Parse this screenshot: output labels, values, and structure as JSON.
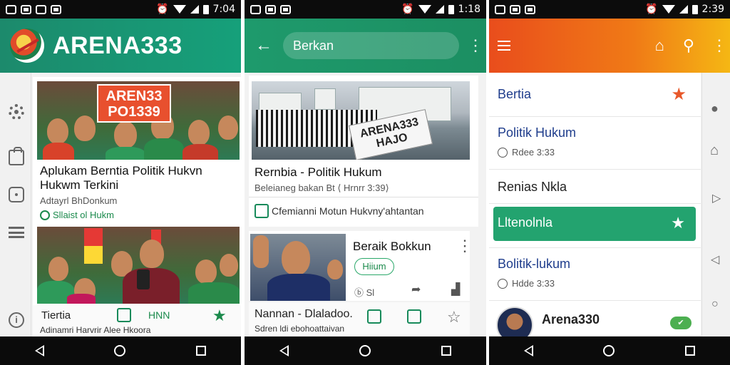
{
  "screens": [
    {
      "status": {
        "time": "7:04"
      },
      "brand": "ARENA333",
      "card1": {
        "sign_line1": "AREN33",
        "sign_line2": "PO1339",
        "title": "Aplukam Berntia Politik Hukvn Hukwm Terkini",
        "meta": "Adtayrl BhDonkum",
        "tag": "Sllaist ol Hukm"
      },
      "footer": {
        "label": "Tiertia",
        "tag": "HNN",
        "sub": "Adinamri Harvrir Alee Hkoora"
      }
    },
    {
      "status": {
        "time": "1:18"
      },
      "search_text": "Berkan",
      "card1": {
        "paper_text": "ARENA333 HAJO",
        "title": "Rernbia - Politik Hukum",
        "meta": "Beleianeg bakan Bt  ⟨ Hrnrr 3:39⟩",
        "footer": "Cfemianni Motun Hukvny'ahtantan"
      },
      "card2": {
        "title": "Beraik Bokkun",
        "pill": "Hiium",
        "count": "ⓑ Sl"
      },
      "card3": {
        "title": "Nannan - Dlaladoo.",
        "sub": "Sdren ldi ebohoattaivan"
      }
    },
    {
      "status": {
        "time": "2:39"
      },
      "items": [
        {
          "title": "Bertia",
          "meta": ""
        },
        {
          "title": "Politik Hukum",
          "meta": "Rdee 3:33"
        },
        {
          "title": "Renias Nkla",
          "meta": ""
        },
        {
          "title": "Lltenolnla",
          "meta": ""
        },
        {
          "title": "Bolitik-lukum",
          "meta": "Hdde 3:33"
        },
        {
          "title": "Arena330",
          "meta": ""
        }
      ],
      "badge": "✔",
      "colors": {
        "accent": "#23a36f",
        "star": "#e8582a",
        "title_blue": "#1f3d8c"
      }
    }
  ]
}
